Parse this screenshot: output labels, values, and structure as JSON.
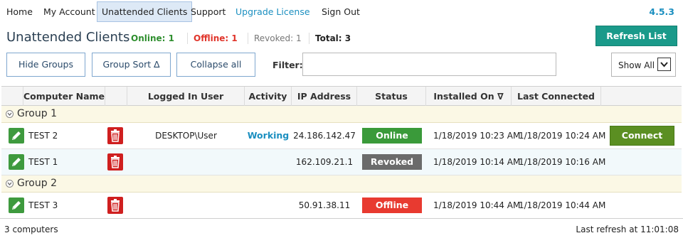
{
  "nav": {
    "items": [
      {
        "label": "Home"
      },
      {
        "label": "My Account"
      },
      {
        "label": "Unattended Clients"
      },
      {
        "label": "Support"
      },
      {
        "label": "Upgrade License"
      },
      {
        "label": "Sign Out"
      }
    ],
    "version": "4.5.3"
  },
  "header": {
    "title": "Unattended Clients",
    "online": "Online: 1",
    "offline": "Offline: 1",
    "revoked": "Revoked: 1",
    "total": "Total: 3",
    "refresh_label": "Refresh List"
  },
  "toolbar": {
    "hide_groups": "Hide Groups",
    "group_sort": "Group Sort ∆",
    "collapse_all": "Collapse all",
    "filter_label": "Filter:",
    "filter_value": "",
    "show_select": "Show All"
  },
  "table": {
    "columns": [
      "Computer Name",
      "Logged In User",
      "Activity",
      "IP Address",
      "Status",
      "Installed On ∇",
      "Last Connected"
    ],
    "groups": [
      {
        "name": "Group 1",
        "rows": [
          {
            "computer": "TEST 2",
            "user": "DESKTOP\\User",
            "activity": "Working",
            "ip": "24.186.142.47",
            "status": "Online",
            "installed": "1/18/2019 10:23 AM",
            "last_connected": "1/18/2019 10:24 AM",
            "action": "Connect"
          },
          {
            "computer": "TEST 1",
            "user": "",
            "activity": "",
            "ip": "162.109.21.1",
            "status": "Revoked",
            "installed": "1/18/2019 10:14 AM",
            "last_connected": "1/18/2019 10:16 AM",
            "action": ""
          }
        ]
      },
      {
        "name": "Group 2",
        "rows": [
          {
            "computer": "TEST 3",
            "user": "",
            "activity": "",
            "ip": "50.91.38.11",
            "status": "Offline",
            "installed": "1/18/2019 10:44 AM",
            "last_connected": "1/18/2019 10:44 AM",
            "action": ""
          }
        ]
      }
    ]
  },
  "colors": {
    "online": "#3a9a3a",
    "revoked": "#6b6b6b",
    "offline": "#e83a30",
    "activity": "#1b8fc0",
    "refresh": "#1a9a8a",
    "connect": "#5b8f22"
  },
  "icons": {
    "edit": "pencil-icon",
    "delete": "trash-icon",
    "group_toggle": "collapse-circle-icon",
    "select": "chevron-down-icon"
  },
  "footer": {
    "count": "3 computers",
    "last_refresh": "Last refresh at 11:01:08"
  }
}
